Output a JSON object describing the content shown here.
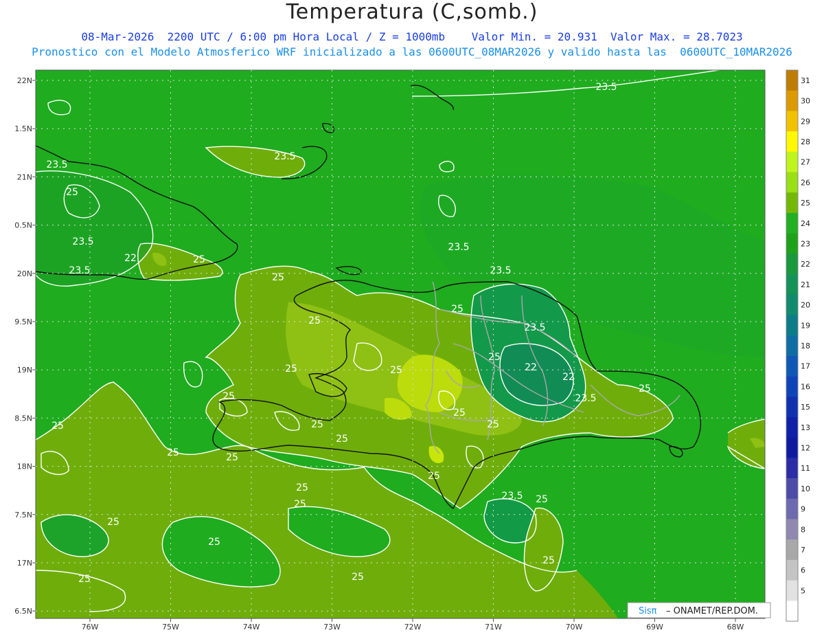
{
  "header": {
    "title": "Temperatura (C,somb.)",
    "line1": "08-Mar-2026  2200 UTC / 6:00 pm Hora Local / Z = 1000mb    Valor Min. = 20.931  Valor Max. = 28.7023",
    "line2": "Pronostico con el Modelo Atmosferico WRF inicializado a las 0600UTC_08MAR2026 y valido hasta las  0600UTC_10MAR2026"
  },
  "map": {
    "lat_labels": [
      "22N",
      "1.5N",
      "21N",
      "0.5N",
      "20N",
      "9.5N",
      "19N",
      "8.5N",
      "18N",
      "7.5N",
      "17N",
      "6.5N"
    ],
    "lon_labels": [
      "76W",
      "75W",
      "74W",
      "73W",
      "72W",
      "71W",
      "70W",
      "69W",
      "68W"
    ],
    "contour_labels": [
      "23.5",
      "25",
      "23.5",
      "22",
      "23.5",
      "23.5",
      "23.5",
      "25",
      "25",
      "23.5",
      "23.5",
      "25",
      "25",
      "23.5",
      "25",
      "22",
      "22",
      "23.5",
      "25",
      "25",
      "25",
      "25",
      "25",
      "25",
      "25",
      "25",
      "25",
      "25",
      "25",
      "25",
      "25",
      "25",
      "25",
      "25",
      "25",
      "23.5",
      "25",
      "25",
      "25"
    ],
    "attribution": {
      "logo": "Sisπ",
      "text": "–  ONAMET/REP.DOM."
    },
    "colors": {
      "ocean": "#1fac1f",
      "land_warm": "#6fae0a",
      "land_warmer": "#8fc014",
      "land_hot": "#c8e60a",
      "cool": "#129a46",
      "contour": "#ffffff",
      "coast": "#111111",
      "border": "#a0a0a0"
    }
  },
  "legend": {
    "ticks": [
      "31",
      "30",
      "29",
      "28",
      "27",
      "26",
      "25",
      "24",
      "23",
      "22",
      "21",
      "20",
      "19",
      "18",
      "17",
      "16",
      "15",
      "13",
      "12",
      "11",
      "10",
      "9",
      "8",
      "7",
      "6",
      "5"
    ],
    "colors": [
      "#c07d05",
      "#dc9a00",
      "#f2c200",
      "#fff800",
      "#bff51a",
      "#9ade14",
      "#74b806",
      "#21b021",
      "#1ea21c",
      "#19983e",
      "#139358",
      "#108b6c",
      "#0c7d88",
      "#0e6ea4",
      "#1058b8",
      "#0f44b8",
      "#1030b0",
      "#1020a8",
      "#101aa0",
      "#2c2ca8",
      "#4c4ca8",
      "#6e6ab0",
      "#9088b0",
      "#a8a8a8",
      "#c4c4c4",
      "#e2e2e2",
      "#ffffff"
    ]
  }
}
